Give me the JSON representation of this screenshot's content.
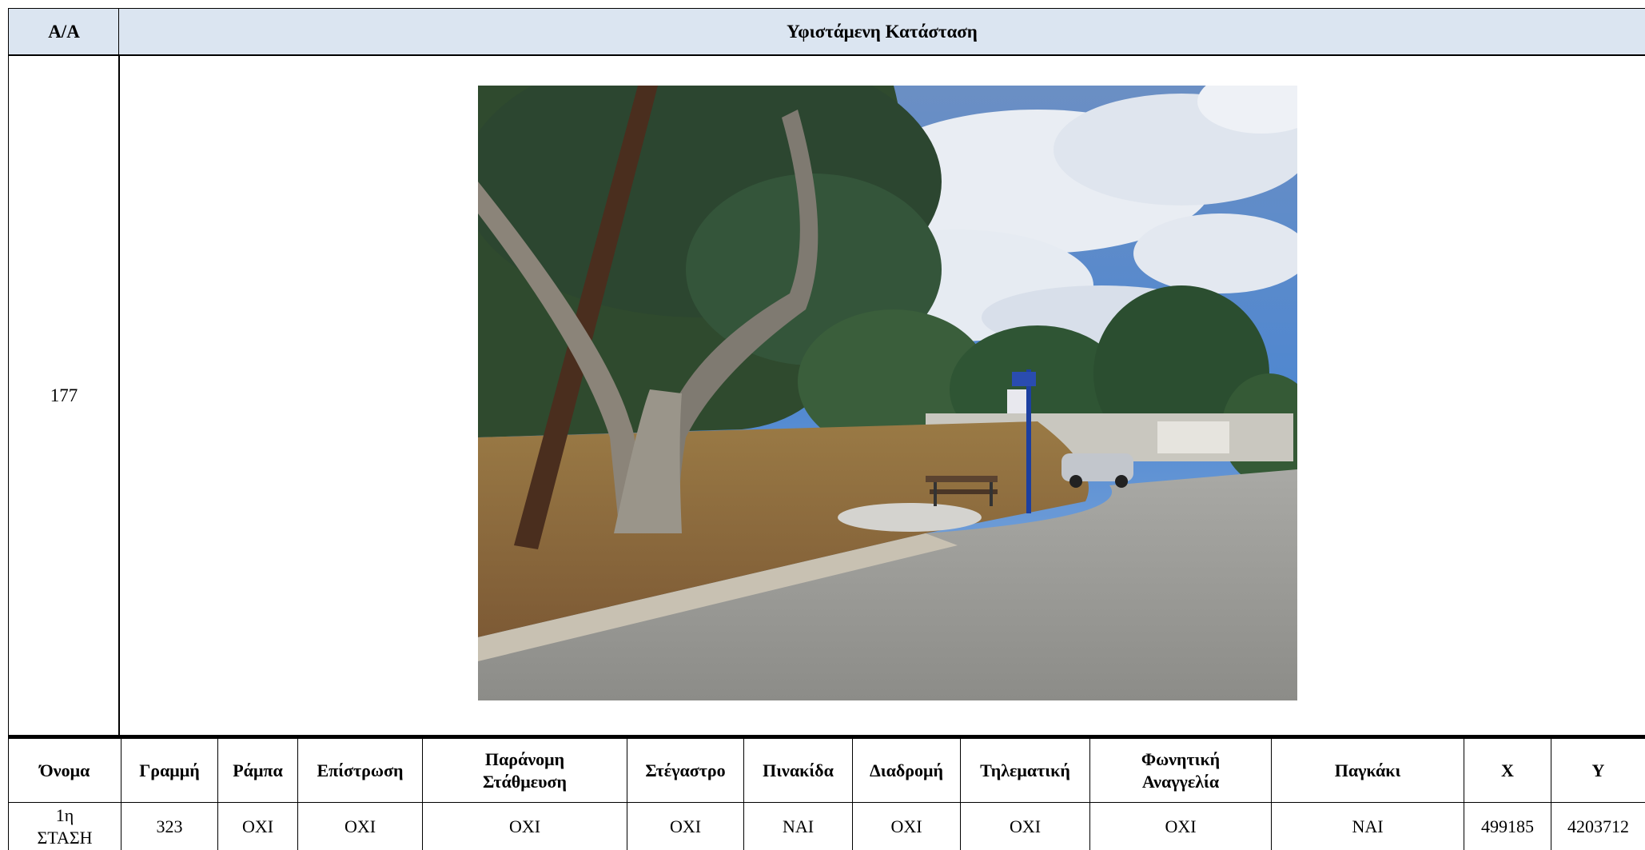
{
  "header": {
    "aa_label": "Α/Α",
    "status_label": "Υφιστάμενη Κατάσταση"
  },
  "record": {
    "id": "177"
  },
  "photo": {
    "icon": "bus-stop-photo"
  },
  "details": {
    "headers": [
      "Όνομα",
      "Γραμμή",
      "Ράμπα",
      "Επίστρωση",
      "Παράνομη Στάθμευση",
      "Στέγαστρο",
      "Πινακίδα",
      "Διαδρομή",
      "Τηλεματική",
      "Φωνητική Αναγγελία",
      "Παγκάκι",
      "X",
      "Y"
    ],
    "row": [
      "1η ΣΤΑΣΗ",
      "323",
      "ΟΧΙ",
      "ΟΧΙ",
      "ΟΧΙ",
      "ΟΧΙ",
      "ΝΑΙ",
      "ΟΧΙ",
      "ΟΧΙ",
      "ΟΧΙ",
      "ΝΑΙ",
      "499185",
      "4203712"
    ]
  }
}
